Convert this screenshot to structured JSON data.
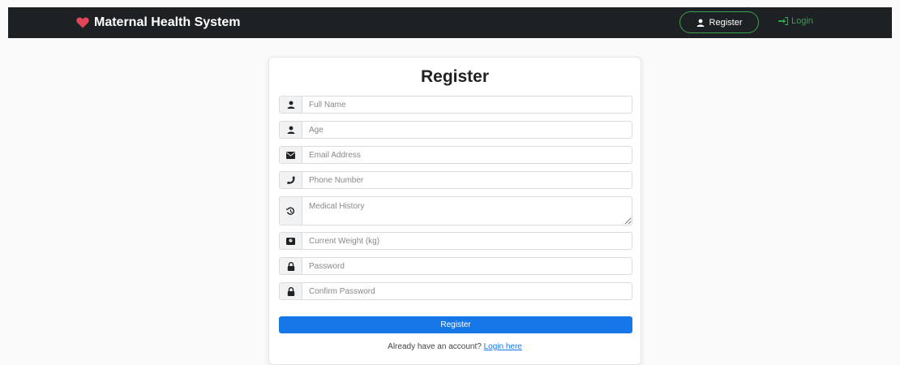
{
  "navbar": {
    "brand": "Maternal Health System",
    "register_label": "Register",
    "login_label": "Login"
  },
  "form": {
    "title": "Register",
    "fields": [
      {
        "placeholder": "Full Name",
        "icon": "user-icon"
      },
      {
        "placeholder": "Age",
        "icon": "user-icon"
      },
      {
        "placeholder": "Email Address",
        "icon": "envelope-icon"
      },
      {
        "placeholder": "Phone Number",
        "icon": "phone-icon"
      },
      {
        "placeholder": "Medical History",
        "icon": "history-icon"
      },
      {
        "placeholder": "Current Weight (kg)",
        "icon": "weight-icon"
      },
      {
        "placeholder": "Password",
        "icon": "lock-icon"
      },
      {
        "placeholder": "Confirm Password",
        "icon": "lock-icon"
      }
    ],
    "submit_label": "Register",
    "footer_text": "Already have an account?",
    "footer_link": "Login here"
  },
  "colors": {
    "navbar": "#1e2124",
    "heart": "#e0465a",
    "primary": "#1677e8",
    "success": "#3aa24b"
  }
}
